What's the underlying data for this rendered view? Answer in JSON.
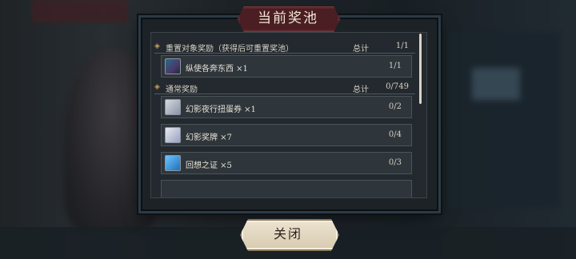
{
  "dialog": {
    "title": "当前奖池",
    "sections": [
      {
        "label": "重置对象奖励（获得后可重置奖池）",
        "total_label": "总计",
        "total_value": "1/1",
        "items": [
          {
            "icon": "cards-icon",
            "name": "纵使各奔东西 ×1",
            "count": "1/1"
          }
        ]
      },
      {
        "label": "通常奖励",
        "total_label": "总计",
        "total_value": "0/749",
        "items": [
          {
            "icon": "ticket-icon",
            "name": "幻影夜行扭蛋券 ×1",
            "count": "0/2"
          },
          {
            "icon": "medal-icon",
            "name": "幻影奖牌 ×7",
            "count": "0/4"
          },
          {
            "icon": "crystal-icon",
            "name": "回想之证 ×5",
            "count": "0/3"
          }
        ]
      }
    ]
  },
  "close_button": {
    "label": "关闭"
  }
}
